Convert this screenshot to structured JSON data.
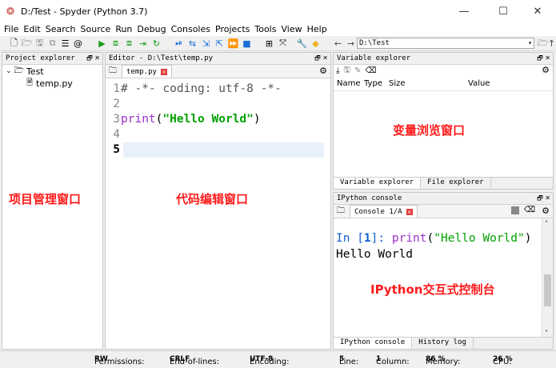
{
  "window": {
    "title": "D:/Test - Spyder (Python 3.7)",
    "minimize": "—",
    "maximize": "☐",
    "close": "✕"
  },
  "menu": [
    "File",
    "Edit",
    "Search",
    "Source",
    "Run",
    "Debug",
    "Consoles",
    "Projects",
    "Tools",
    "View",
    "Help"
  ],
  "toolbar": {
    "path": "D:\\Test"
  },
  "project_explorer": {
    "header": "Project explorer",
    "folder": "Test",
    "file": "temp.py",
    "overlay_label": "项目管理窗口"
  },
  "editor": {
    "header": "Editor - D:\\Test\\temp.py",
    "tab": "temp.py",
    "lines": [
      {
        "n": "1",
        "text": "# -*- coding: utf-8 -*-"
      },
      {
        "n": "2",
        "text": ""
      },
      {
        "n": "3",
        "kw": "print",
        "open": "(",
        "str": "\"Hello World\"",
        "close": ")"
      },
      {
        "n": "4",
        "text": ""
      },
      {
        "n": "5",
        "text": ""
      }
    ],
    "overlay_label": "代码编辑窗口"
  },
  "variable_explorer": {
    "header": "Variable explorer",
    "columns": [
      "Name",
      "Type",
      "Size",
      "Value"
    ],
    "overlay_label": "变量浏览窗口",
    "tabs": [
      "Variable explorer",
      "File explorer"
    ]
  },
  "ipython": {
    "header": "IPython console",
    "tab": "Console 1/A",
    "prompt_in": "In [",
    "prompt_num": "1",
    "prompt_close": "]: ",
    "cmd_kw": "print",
    "cmd_open": "(",
    "cmd_str": "\"Hello World\"",
    "cmd_close": ")",
    "output": "Hello World",
    "overlay_label": "IPython交互式控制台",
    "tabs": [
      "IPython console",
      "History log"
    ]
  },
  "statusbar": {
    "permissions_label": "Permissions:",
    "permissions": "RW",
    "eol_label": "End-of-lines:",
    "eol": "CRLF",
    "encoding_label": "Encoding:",
    "encoding": "UTF-8",
    "line_label": "Line:",
    "line": "5",
    "column_label": "Column:",
    "column": "1",
    "memory_label": "Memory:",
    "memory": "86 %",
    "cpu_label": "CPU:",
    "cpu": "26 %"
  },
  "colors": {
    "keyword": "#9b30c8",
    "string": "#00a000",
    "prompt": "#1060d0",
    "label": "#ff1a1a"
  }
}
